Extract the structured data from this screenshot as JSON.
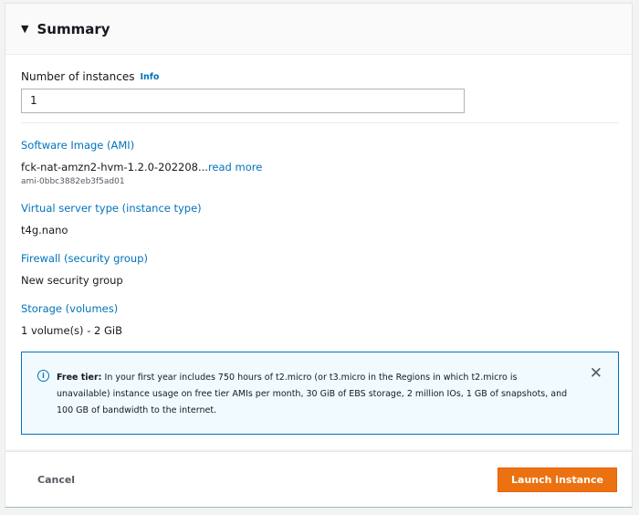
{
  "summary": {
    "title": "Summary",
    "instances": {
      "label": "Number of instances",
      "info_link": "Info",
      "value": "1"
    },
    "ami": {
      "label": "Software Image (AMI)",
      "value": "fck-nat-amzn2-hvm-1.2.0-202208...",
      "read_more": "read more",
      "ami_id": "ami-0bbc3882eb3f5ad01"
    },
    "instance_type": {
      "label": "Virtual server type (instance type)",
      "value": "t4g.nano"
    },
    "firewall": {
      "label": "Firewall (security group)",
      "value": "New security group"
    },
    "storage": {
      "label": "Storage (volumes)",
      "value": "1 volume(s) - 2 GiB"
    },
    "alert": {
      "title": "Free tier:",
      "text": " In your first year includes 750 hours of t2.micro (or t3.micro in the Regions in which t2.micro is unavailable) instance usage on free tier AMIs per month, 30 GiB of EBS storage, 2 million IOs, 1 GB of snapshots, and 100 GB of bandwidth to the internet.",
      "icon": "info-icon",
      "close_icon": "close-icon"
    }
  },
  "footer": {
    "cancel_label": "Cancel",
    "launch_label": "Launch instance",
    "launch_color": "#ec7211"
  }
}
